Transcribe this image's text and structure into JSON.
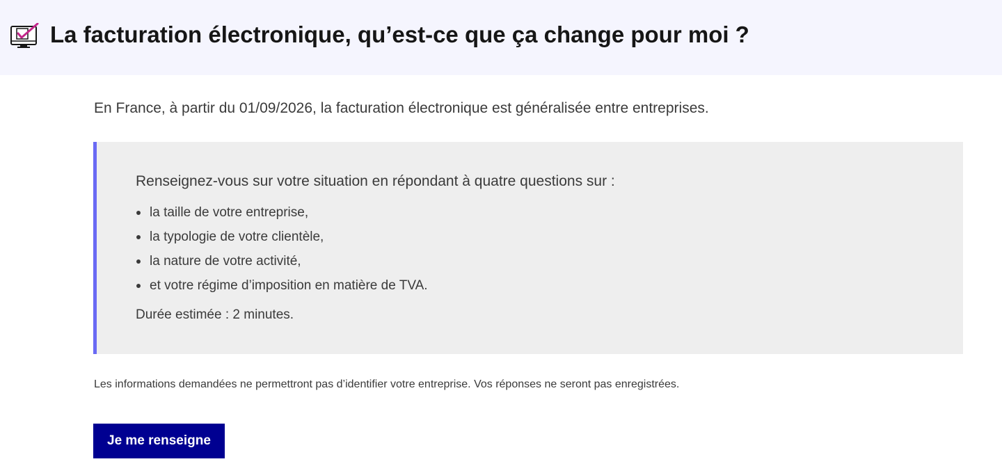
{
  "header": {
    "icon": "checkbox-monitor-icon",
    "title": "La facturation électronique, qu’est-ce que ça change pour moi ?",
    "background": "#f5f5fe"
  },
  "intro": {
    "text": "En France, à partir du 01/09/2026, la facturation électronique est généralisée entre entreprises."
  },
  "callout": {
    "lead": "Renseignez-vous sur votre situation en répondant à quatre questions sur :",
    "items": [
      "la taille de votre entreprise,",
      "la typologie de votre clientèle,",
      "la nature de votre activité,",
      "et votre régime d’imposition en matière de TVA."
    ],
    "duration": "Durée estimée : 2 minutes.",
    "accent_color": "#6a6af4",
    "background": "#eeeeee"
  },
  "disclaimer": {
    "text": "Les informations demandées ne permettront pas d’identifier votre entreprise. Vos réponses ne seront pas enregistrées."
  },
  "cta": {
    "label": "Je me renseigne",
    "color": "#000091"
  }
}
